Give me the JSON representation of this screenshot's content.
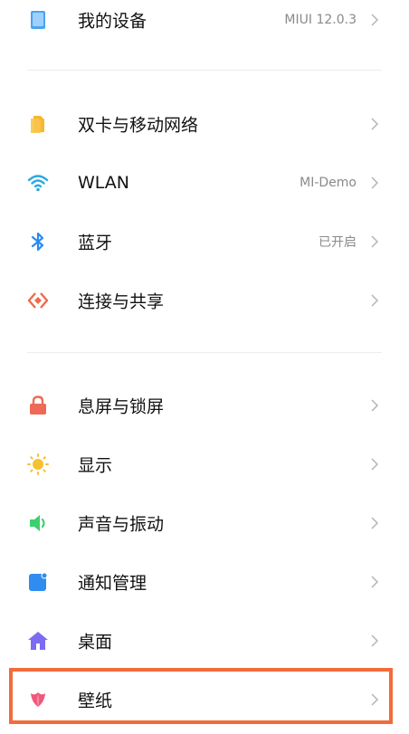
{
  "items": [
    {
      "label": "我的设备",
      "value": "MIUI 12.0.3",
      "icon": "device-icon",
      "color": "#4aa3f5"
    },
    {
      "label": "双卡与移动网络",
      "value": "",
      "icon": "sim-card-icon",
      "color": "#f7b731"
    },
    {
      "label": "WLAN",
      "value": "MI-Demo",
      "icon": "wifi-icon",
      "color": "#2aa8e0"
    },
    {
      "label": "蓝牙",
      "value": "已开启",
      "icon": "bluetooth-icon",
      "color": "#2b8af2"
    },
    {
      "label": "连接与共享",
      "value": "",
      "icon": "connection-share-icon",
      "color": "#ee6a4a"
    },
    {
      "label": "息屏与锁屏",
      "value": "",
      "icon": "lock-icon",
      "color": "#ee6a56"
    },
    {
      "label": "显示",
      "value": "",
      "icon": "sun-icon",
      "color": "#f7c02f"
    },
    {
      "label": "声音与振动",
      "value": "",
      "icon": "speaker-icon",
      "color": "#3dd06f"
    },
    {
      "label": "通知管理",
      "value": "",
      "icon": "notification-icon",
      "color": "#2f8cf0"
    },
    {
      "label": "桌面",
      "value": "",
      "icon": "home-icon",
      "color": "#7b6cf2"
    },
    {
      "label": "壁纸",
      "value": "",
      "icon": "tulip-icon",
      "color": "#f0587a"
    }
  ],
  "highlight_color": "#f26b3a"
}
